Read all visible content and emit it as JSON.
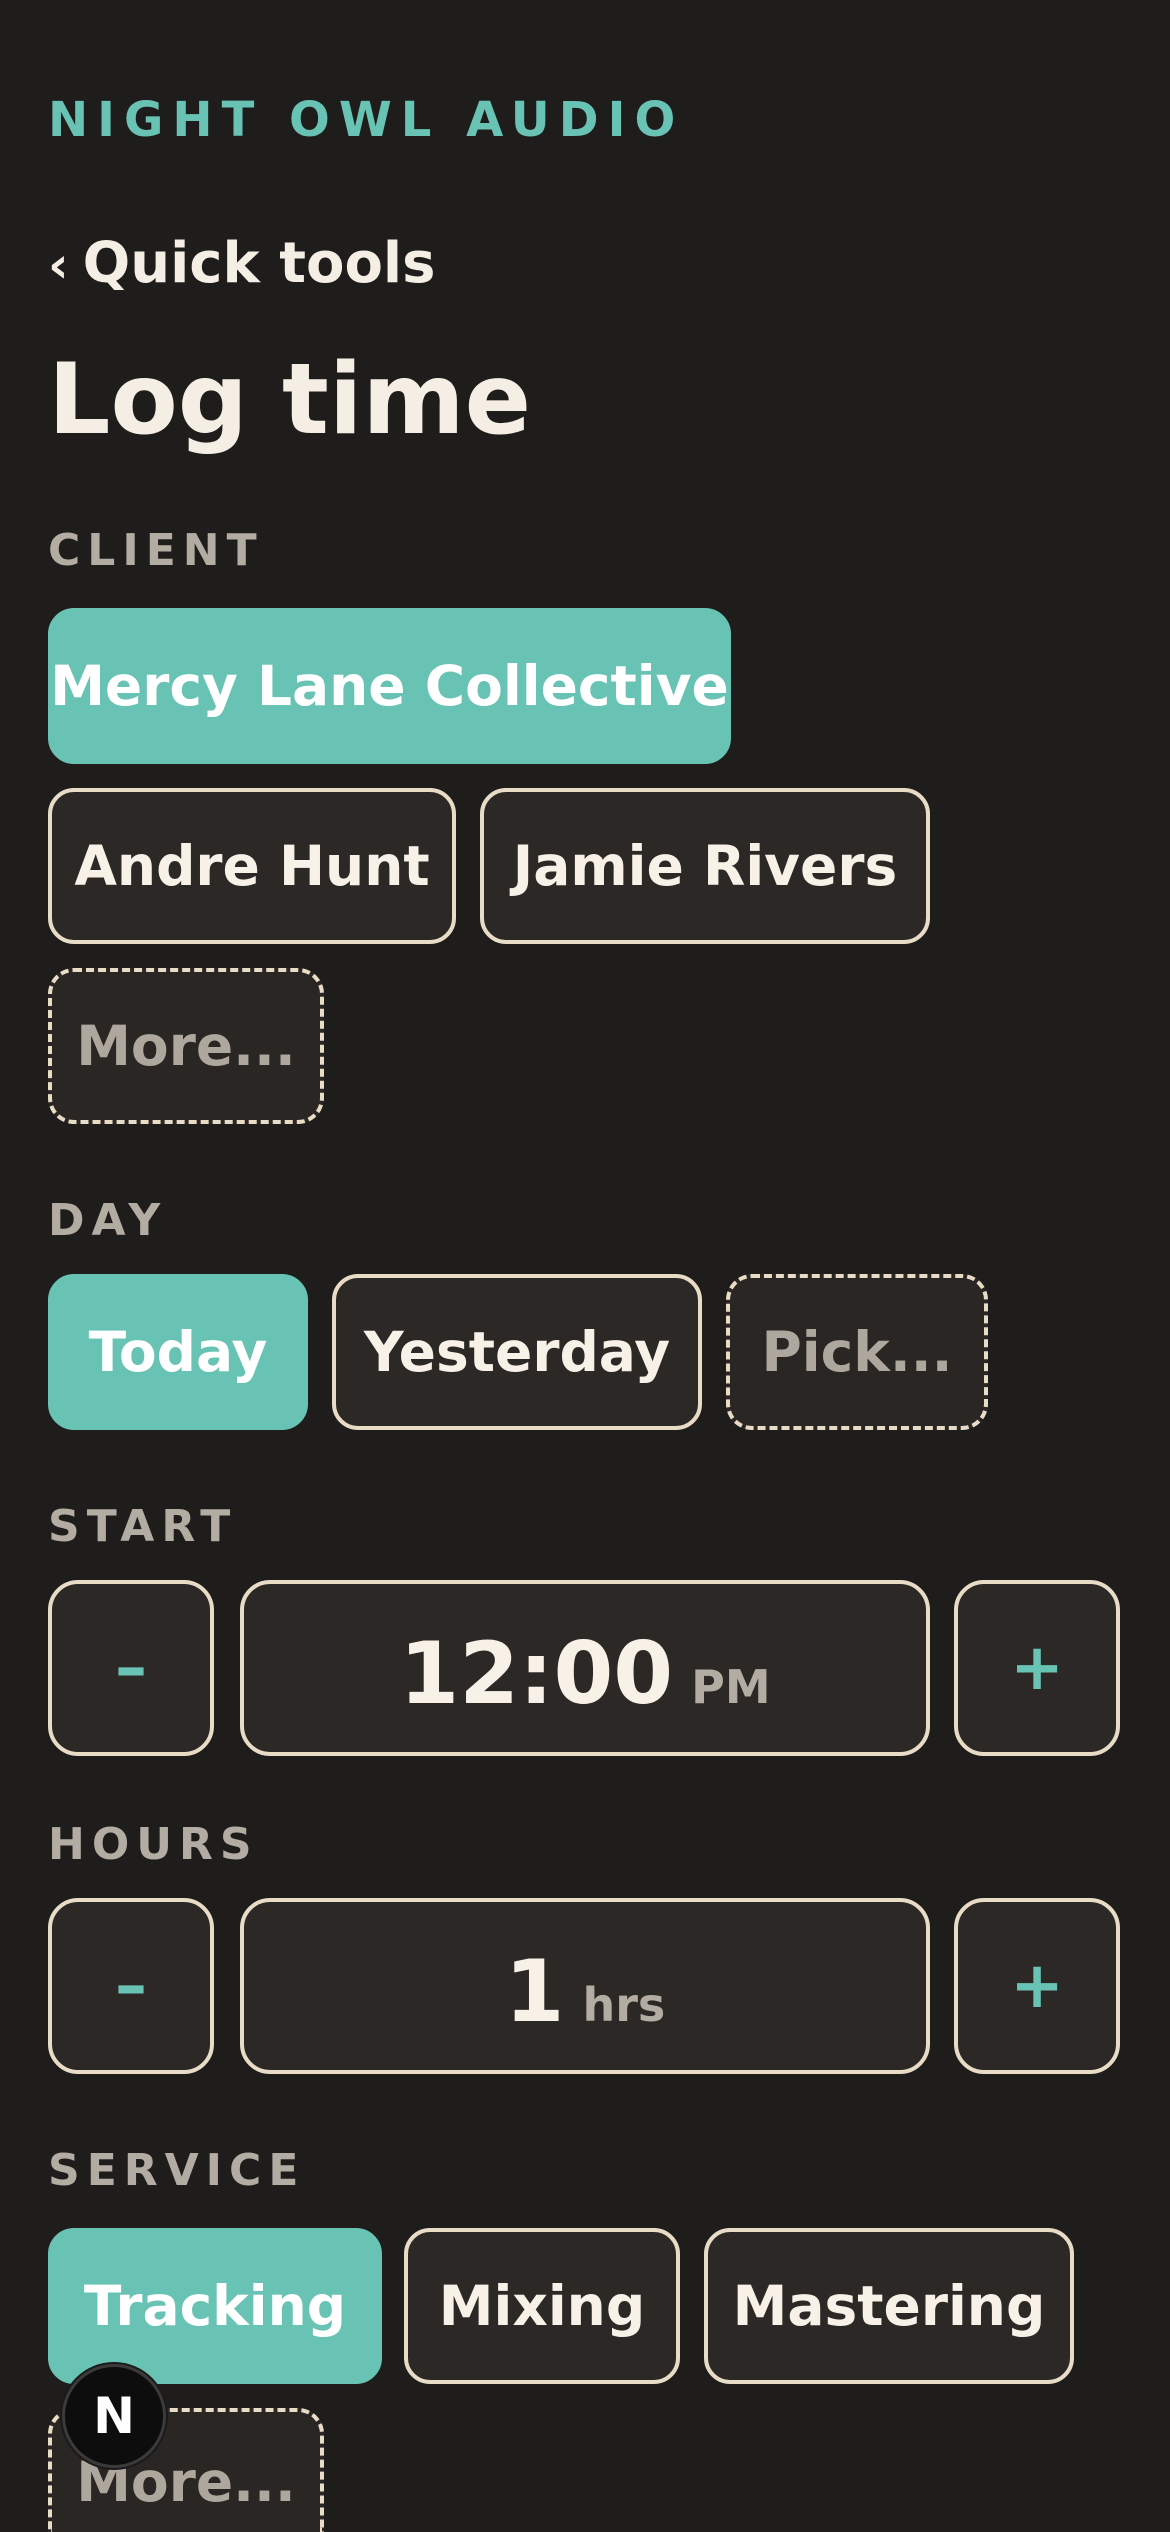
{
  "app": {
    "brand": "NIGHT OWL AUDIO"
  },
  "nav": {
    "back_chevron": "‹",
    "back_label": "Quick tools"
  },
  "page": {
    "title": "Log time"
  },
  "client": {
    "label": "CLIENT",
    "options": [
      "Mercy Lane Collective",
      "Andre Hunt",
      "Jamie Rivers"
    ],
    "selected": "Mercy Lane Collective",
    "more_label": "More..."
  },
  "day": {
    "label": "DAY",
    "options": [
      "Today",
      "Yesterday"
    ],
    "selected": "Today",
    "pick_label": "Pick..."
  },
  "start": {
    "label": "START",
    "decrement": "–",
    "increment": "+",
    "value": "12:00",
    "meridiem": "PM"
  },
  "hours": {
    "label": "HOURS",
    "decrement": "–",
    "increment": "+",
    "value": "1",
    "unit": "hrs"
  },
  "service": {
    "label": "SERVICE",
    "options": [
      "Tracking",
      "Mixing",
      "Mastering"
    ],
    "selected": "Tracking",
    "more_label": "More..."
  },
  "badge": {
    "letter": "N",
    "icon": "next-logo-icon"
  },
  "colors": {
    "background": "#1f1d1c",
    "accent": "#69c3b4",
    "chip_border": "#e8dcc6",
    "muted_text": "#b3aca2"
  }
}
